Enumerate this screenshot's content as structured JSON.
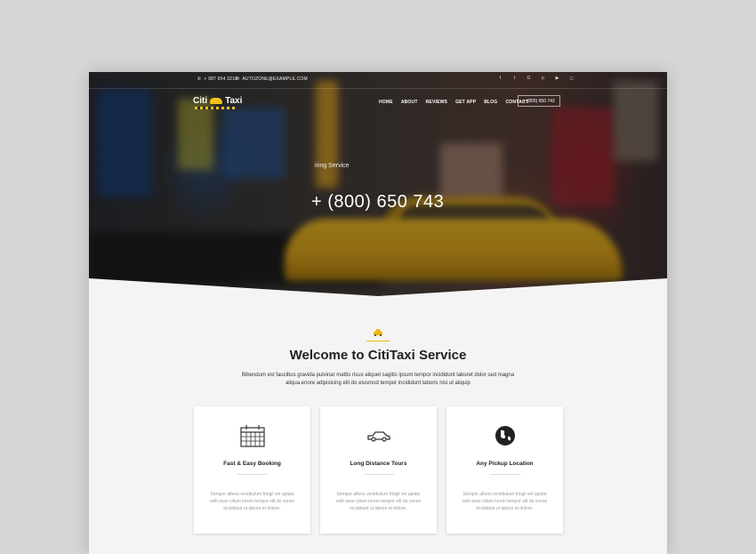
{
  "topbar": {
    "phone": "+ 987 654 3210",
    "email": "AUTOZONE@EXAMPLE.COM",
    "socials": [
      "facebook-icon",
      "twitter-icon",
      "google-plus-icon",
      "pinterest-icon",
      "youtube-icon",
      "instagram-icon"
    ]
  },
  "header": {
    "logo_part1": "Citi",
    "logo_part2": "Taxi",
    "nav": [
      "HOME",
      "ABOUT",
      "REVIEWS",
      "GET APP",
      "BLOG",
      "CONTACT"
    ],
    "phone_button": "+ (800) 650 743"
  },
  "hero": {
    "subtitle": "iring Service",
    "phone": "+ (800) 650 743"
  },
  "welcome": {
    "title": "Welcome to CitiTaxi Service",
    "text": "Bibendum est faucibus gravida pulvinar mattis risus aliquet sagitis ipsum tempor incididunt laboret dolor sed magna aliqua enore adipisicing elit do eiusmod tempor incididunt laboris nisi ut aliquip"
  },
  "cards": [
    {
      "icon": "calendar-icon",
      "title": "Fast & Easy Booking",
      "text": "Semper albers vestibulum fringil vel uptate velit esse cillum lorem tempor elit do conse incididunt ut labore et dolore."
    },
    {
      "icon": "car-icon",
      "title": "Long Distance Tours",
      "text": "Semper albers vestibulum fringil vel uptate velit esse cillum lorem tempor elit do conse incididunt ut labore et dolore."
    },
    {
      "icon": "globe-icon",
      "title": "Any Pickup Location",
      "text": "Semper albers vestibulum fringil vel uptate velit esse cillum lorem tempor elit do conse incididunt ut labore et dolore."
    }
  ],
  "colors": {
    "accent": "#f2b705",
    "background": "#f4f4f4",
    "text": "#222222"
  }
}
